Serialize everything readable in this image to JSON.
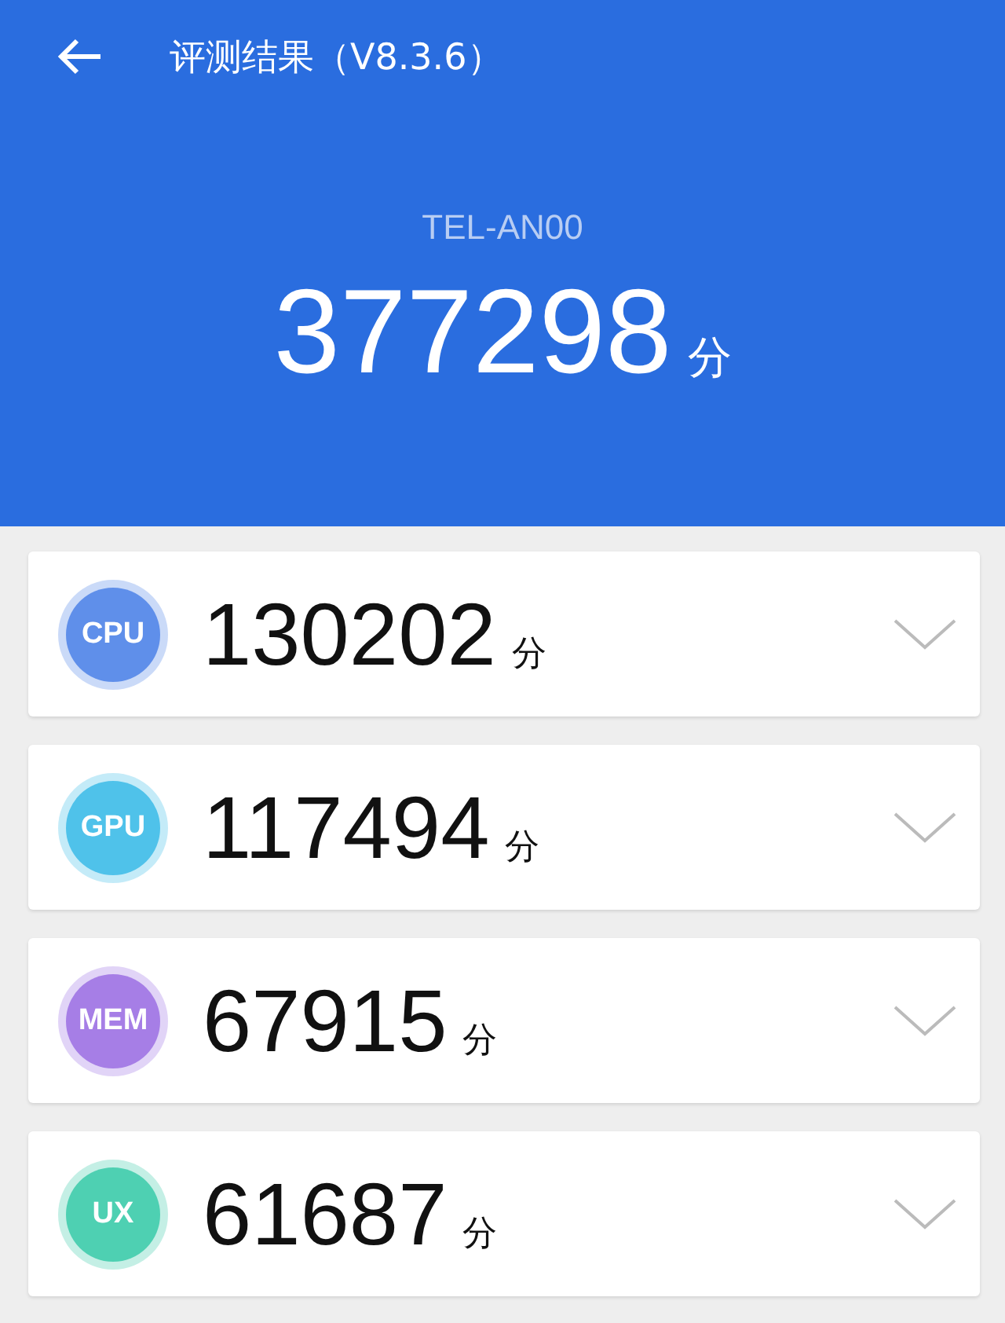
{
  "header": {
    "title": "评测结果（V8.3.6）",
    "device": "TEL-AN00",
    "total_score": "377298",
    "unit": "分"
  },
  "categories": [
    {
      "label": "CPU",
      "score": "130202",
      "unit": "分",
      "color": "#5f8fea",
      "expanded": false
    },
    {
      "label": "GPU",
      "score": "117494",
      "unit": "分",
      "color": "#4fc2ea",
      "expanded": false
    },
    {
      "label": "MEM",
      "score": "67915",
      "unit": "分",
      "color": "#a67ee6",
      "expanded": false
    },
    {
      "label": "UX",
      "score": "61687",
      "unit": "分",
      "color": "#4ed0b2",
      "expanded": false
    }
  ]
}
